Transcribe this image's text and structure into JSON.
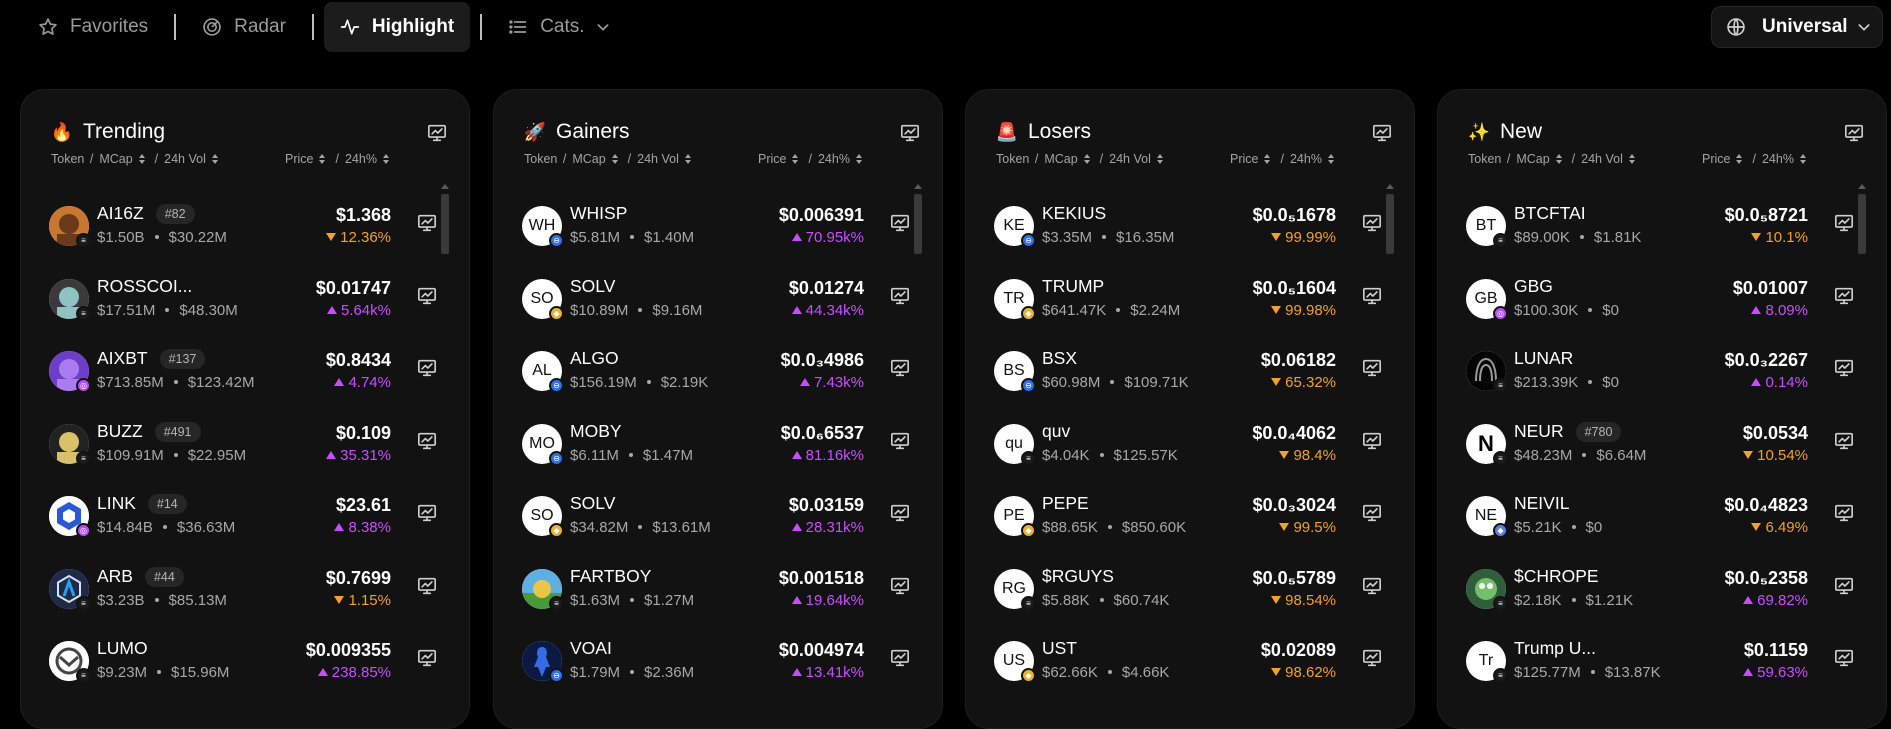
{
  "nav": {
    "tabs": [
      {
        "label": "Favorites",
        "icon": "star-icon"
      },
      {
        "label": "Radar",
        "icon": "radar-icon"
      },
      {
        "label": "Highlight",
        "icon": "pulse-icon"
      },
      {
        "label": "Cats.",
        "icon": "list-icon"
      }
    ],
    "network": "Universal",
    "active_tab": "Highlight"
  },
  "colors": {
    "up": "#c84dff",
    "down": "#f2a12a",
    "panel": "#121212"
  },
  "headers": {
    "token": "Token",
    "mcap": "MCap",
    "vol": "24h Vol",
    "price": "Price",
    "chg": "24h%"
  },
  "panels": [
    {
      "title": "Trending",
      "emoji": "🔥",
      "rows": [
        {
          "name": "AI16Z",
          "rank": "#82",
          "mcap": "$1.50B",
          "vol": "$30.22M",
          "price": "$1.368",
          "change": "12.36%",
          "dir": "down",
          "avatar": "",
          "chain": "sol"
        },
        {
          "name": "ROSSCOI...",
          "rank": "",
          "mcap": "$17.51M",
          "vol": "$48.30M",
          "price": "$0.01747",
          "change": "5.64k%",
          "dir": "up",
          "avatar": "",
          "chain": "sol"
        },
        {
          "name": "AIXBT",
          "rank": "#137",
          "mcap": "$713.85M",
          "vol": "$123.42M",
          "price": "$0.8434",
          "change": "4.74%",
          "dir": "up",
          "avatar": "",
          "chain": "base"
        },
        {
          "name": "BUZZ",
          "rank": "#491",
          "mcap": "$109.91M",
          "vol": "$22.95M",
          "price": "$0.109",
          "change": "35.31%",
          "dir": "up",
          "avatar": "",
          "chain": "sol"
        },
        {
          "name": "LINK",
          "rank": "#14",
          "mcap": "$14.84B",
          "vol": "$36.63M",
          "price": "$23.61",
          "change": "8.38%",
          "dir": "up",
          "avatar": "",
          "chain": "base"
        },
        {
          "name": "ARB",
          "rank": "#44",
          "mcap": "$3.23B",
          "vol": "$85.13M",
          "price": "$0.7699",
          "change": "1.15%",
          "dir": "down",
          "avatar": "",
          "chain": "sol"
        },
        {
          "name": "LUMO",
          "rank": "",
          "mcap": "$9.23M",
          "vol": "$15.96M",
          "price": "$0.009355",
          "change": "238.85%",
          "dir": "up",
          "avatar": "",
          "chain": "sol"
        }
      ]
    },
    {
      "title": "Gainers",
      "emoji": "🚀",
      "rows": [
        {
          "name": "WHISP",
          "rank": "",
          "mcap": "$5.81M",
          "vol": "$1.40M",
          "price": "$0.006391",
          "change": "70.95k%",
          "dir": "up",
          "avatar": "WH",
          "chain": "blue"
        },
        {
          "name": "SOLV",
          "rank": "",
          "mcap": "$10.89M",
          "vol": "$9.16M",
          "price": "$0.01274",
          "change": "44.34k%",
          "dir": "up",
          "avatar": "SO",
          "chain": "bnb"
        },
        {
          "name": "ALGO",
          "rank": "",
          "mcap": "$156.19M",
          "vol": "$2.19K",
          "price": "$0.0₃4986",
          "change": "7.43k%",
          "dir": "up",
          "avatar": "AL",
          "chain": "blue"
        },
        {
          "name": "MOBY",
          "rank": "",
          "mcap": "$6.11M",
          "vol": "$1.47M",
          "price": "$0.0₆6537",
          "change": "81.16k%",
          "dir": "up",
          "avatar": "MO",
          "chain": "blue"
        },
        {
          "name": "SOLV",
          "rank": "",
          "mcap": "$34.82M",
          "vol": "$13.61M",
          "price": "$0.03159",
          "change": "28.31k%",
          "dir": "up",
          "avatar": "SO",
          "chain": "bnb"
        },
        {
          "name": "FARTBOY",
          "rank": "",
          "mcap": "$1.63M",
          "vol": "$1.27M",
          "price": "$0.001518",
          "change": "19.64k%",
          "dir": "up",
          "avatar": "",
          "chain": "sol"
        },
        {
          "name": "VOAI",
          "rank": "",
          "mcap": "$1.79M",
          "vol": "$2.36M",
          "price": "$0.004974",
          "change": "13.41k%",
          "dir": "up",
          "avatar": "",
          "chain": "blue"
        }
      ]
    },
    {
      "title": "Losers",
      "emoji": "🚨",
      "rows": [
        {
          "name": "KEKIUS",
          "rank": "",
          "mcap": "$3.35M",
          "vol": "$16.35M",
          "price": "$0.0₅1678",
          "change": "99.99%",
          "dir": "down",
          "avatar": "KE",
          "chain": "blue"
        },
        {
          "name": "TRUMP",
          "rank": "",
          "mcap": "$641.47K",
          "vol": "$2.24M",
          "price": "$0.0₅1604",
          "change": "99.98%",
          "dir": "down",
          "avatar": "TR",
          "chain": "bnb"
        },
        {
          "name": "BSX",
          "rank": "",
          "mcap": "$60.98M",
          "vol": "$109.71K",
          "price": "$0.06182",
          "change": "65.32%",
          "dir": "down",
          "avatar": "BS",
          "chain": "blue"
        },
        {
          "name": "quv",
          "rank": "",
          "mcap": "$4.04K",
          "vol": "$125.57K",
          "price": "$0.0₄4062",
          "change": "98.4%",
          "dir": "down",
          "avatar": "qu",
          "chain": "sol"
        },
        {
          "name": "PEPE",
          "rank": "",
          "mcap": "$88.65K",
          "vol": "$850.60K",
          "price": "$0.0₃3024",
          "change": "99.5%",
          "dir": "down",
          "avatar": "PE",
          "chain": "bnb"
        },
        {
          "name": "$RGUYS",
          "rank": "",
          "mcap": "$5.88K",
          "vol": "$60.74K",
          "price": "$0.0₅5789",
          "change": "98.54%",
          "dir": "down",
          "avatar": "RG",
          "chain": "sol"
        },
        {
          "name": "UST",
          "rank": "",
          "mcap": "$62.66K",
          "vol": "$4.66K",
          "price": "$0.02089",
          "change": "98.62%",
          "dir": "down",
          "avatar": "US",
          "chain": "bnb"
        }
      ]
    },
    {
      "title": "New",
      "emoji": "✨",
      "rows": [
        {
          "name": "BTCFTAI",
          "rank": "",
          "mcap": "$89.00K",
          "vol": "$1.81K",
          "price": "$0.0₅8721",
          "change": "10.1%",
          "dir": "down",
          "avatar": "BT",
          "chain": "sol"
        },
        {
          "name": "GBG",
          "rank": "",
          "mcap": "$100.30K",
          "vol": "$0",
          "price": "$0.01007",
          "change": "8.09%",
          "dir": "up",
          "avatar": "GB",
          "chain": "base"
        },
        {
          "name": "LUNAR",
          "rank": "",
          "mcap": "$213.39K",
          "vol": "$0",
          "price": "$0.0₃2267",
          "change": "0.14%",
          "dir": "up",
          "avatar": "",
          "chain": "sol"
        },
        {
          "name": "NEUR",
          "rank": "#780",
          "mcap": "$48.23M",
          "vol": "$6.64M",
          "price": "$0.0534",
          "change": "10.54%",
          "dir": "down",
          "avatar": "N",
          "chain": "sol"
        },
        {
          "name": "NEIVIL",
          "rank": "",
          "mcap": "$5.21K",
          "vol": "$0",
          "price": "$0.0₄4823",
          "change": "6.49%",
          "dir": "down",
          "avatar": "NE",
          "chain": "eth"
        },
        {
          "name": "$CHROPE",
          "rank": "",
          "mcap": "$2.18K",
          "vol": "$1.21K",
          "price": "$0.0₅2358",
          "change": "69.82%",
          "dir": "up",
          "avatar": "",
          "chain": "sol"
        },
        {
          "name": "Trump U...",
          "rank": "",
          "mcap": "$125.77M",
          "vol": "$13.87K",
          "price": "$0.1159",
          "change": "59.63%",
          "dir": "up",
          "avatar": "Tr",
          "chain": "sol"
        }
      ]
    }
  ]
}
